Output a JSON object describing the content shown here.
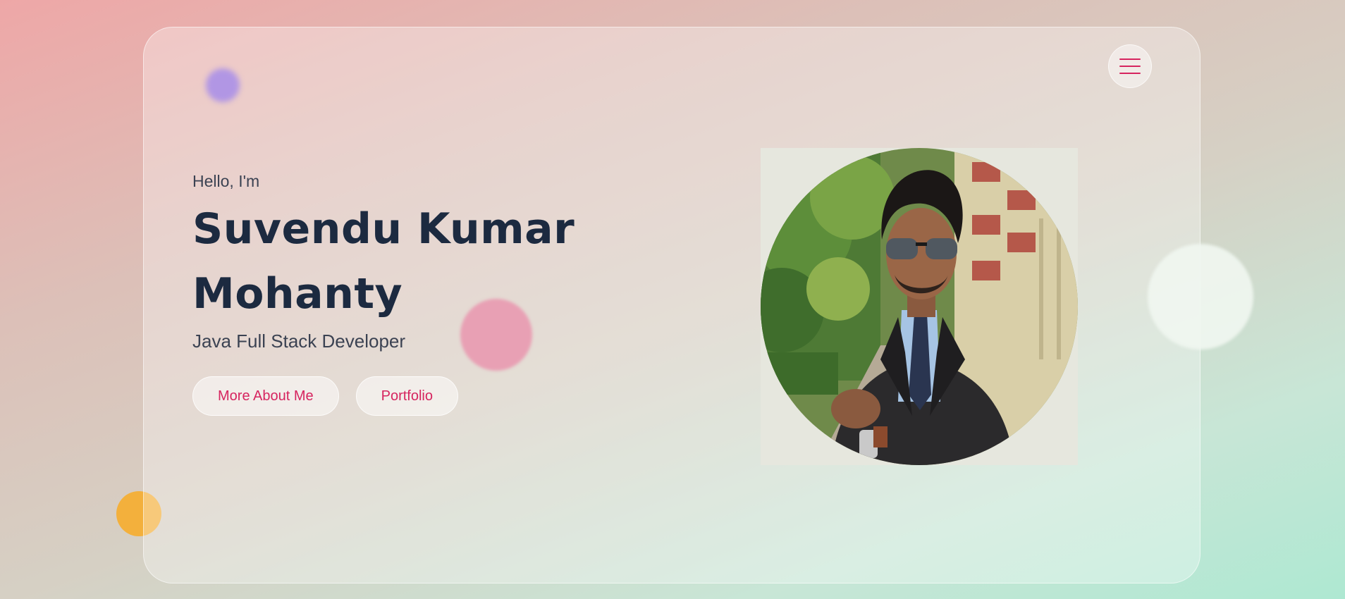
{
  "header": {
    "menu_icon": "hamburger-menu-icon"
  },
  "hero": {
    "greeting": "Hello, I'm",
    "name_line1": "Suvendu Kumar",
    "name_line2": "Mohanty",
    "role": "Java Full Stack Developer",
    "buttons": {
      "more_about": "More About Me",
      "portfolio": "Portfolio"
    }
  },
  "colors": {
    "accent": "#d6245f",
    "heading": "#1c2a40",
    "text": "#3b4252"
  }
}
